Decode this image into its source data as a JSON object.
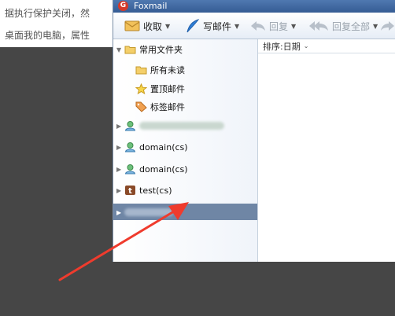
{
  "background_doc": {
    "line1": "据执行保护关闭，然",
    "line2": "桌面我的电脑，属性"
  },
  "window": {
    "title": "Foxmail"
  },
  "toolbar": {
    "receive_label": "收取",
    "compose_label": "写邮件",
    "reply_label": "回复",
    "reply_all_label": "回复全部"
  },
  "sidebar": {
    "section_label": "常用文件夹",
    "items": [
      {
        "label": "所有未读"
      },
      {
        "label": "置顶邮件"
      },
      {
        "label": "标签邮件"
      }
    ],
    "accounts": [
      {
        "label": ""
      },
      {
        "label": "domain(cs)"
      },
      {
        "label": "domain(cs)"
      },
      {
        "label": "test(cs)"
      },
      {
        "label": ""
      }
    ]
  },
  "list": {
    "sort_label": "排序:日期"
  },
  "colors": {
    "accent": "#ef3b2d",
    "selected_row": "#6f86a5",
    "titlebar": "#355c94"
  }
}
